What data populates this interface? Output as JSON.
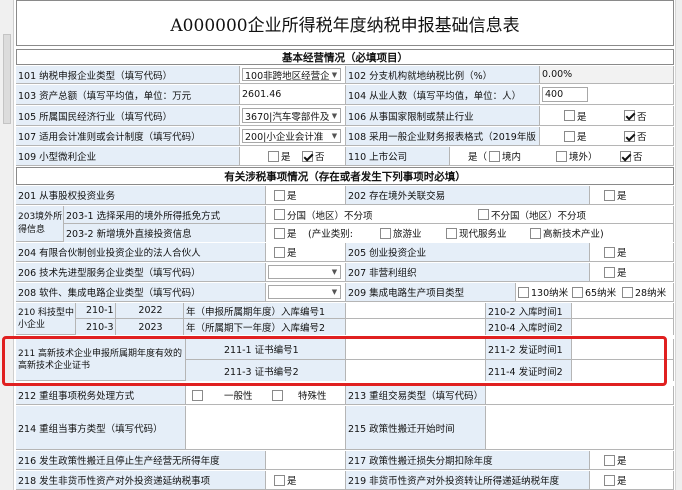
{
  "title": "A000000企业所得税年度纳税申报基础信息表",
  "sec1": "基本经营情况（必填项目）",
  "sec2": "有关涉税事项情况（存在或者发生下列事项时必填）",
  "r101": {
    "l": "101 纳税申报企业类型（填写代码）",
    "v": "100非跨地区经营企",
    "l2": "102 分支机构就地纳税比例（%）",
    "v2": "0.00%"
  },
  "r103": {
    "l": "103 资产总额（填写平均值，单位：万元",
    "v": "2601.46",
    "l2": "104 从业人数（填写平均值，单位：人）",
    "v2": "400"
  },
  "r105": {
    "l": "105 所属国民经济行业（填写代码）",
    "v": "3670|汽车零部件及",
    "l2": "106 从事国家限制或禁止行业"
  },
  "r107": {
    "l": "107 适用会计准则或会计制度（填写代码）",
    "v": "200|小企业会计准",
    "l2": "108 采用一般企业财务报表格式（2019年版"
  },
  "r109": {
    "l": "109 小型微利企业",
    "l2": "110 上市公司",
    "in": "境内",
    "out": "境外"
  },
  "yes": "是",
  "no": "否",
  "r201": {
    "l": "201 从事股权投资业务",
    "l2": "202 存在境外关联交易"
  },
  "r203": {
    "l": "203境外所得信息",
    "a": "203-1 选择采用的境外所得抵免方式",
    "a1": "分国（地区）不分项",
    "a2": "不分国（地区）不分项",
    "b": "203-2 新增境外直接投资信息",
    "b0": "(产业类别:",
    "b1": "旅游业",
    "b2": "现代服务业",
    "b3": "高新技术产业)"
  },
  "r204": {
    "l": "204 有限合伙制创业投资企业的法人合伙人",
    "l2": "205 创业投资企业"
  },
  "r206": {
    "l": "206 技术先进型服务企业类型（填写代码）",
    "l2": "207 非营利组织"
  },
  "r208": {
    "l": "208 软件、集成电路企业类型（填写代码）",
    "l2": "209 集成电路生产项目类型",
    "o1": "130纳米",
    "o2": "65纳米",
    "o3": "28纳米"
  },
  "r210": {
    "l": "210 科技型中小企业",
    "a": "210-1",
    "ay": "2022",
    "at": "年（申报所属期年度）入库编号1",
    "a2": "210-2 入库时间1",
    "b": "210-3",
    "by": "2023",
    "bt": "年（所属期下一年度）入库编号2",
    "b2": "210-4 入库时间2"
  },
  "r211": {
    "l": "211 高新技术企业申报所属期年度有效的高新技术企业证书",
    "a": "211-1 证书编号1",
    "a2": "211-2 发证时间1",
    "b": "211-3 证书编号2",
    "b2": "211-4 发证时间2"
  },
  "r212": {
    "l": "212 重组事项税务处理方式",
    "o1": "一般性",
    "o2": "特殊性",
    "l2": "213 重组交易类型（填写代码）"
  },
  "r214": {
    "l": "214 重组当事方类型（填写代码）",
    "l2": "215 政策性搬迁开始时间"
  },
  "r216": {
    "l": "216 发生政策性搬迁且停止生产经营无所得年度",
    "l2": "217 政策性搬迁损失分期扣除年度"
  },
  "r218": {
    "l": "218 发生非货币性资产对外投资递延纳税事项",
    "l2": "219 非货币性资产对外投资转让所得递延纳税年度"
  }
}
